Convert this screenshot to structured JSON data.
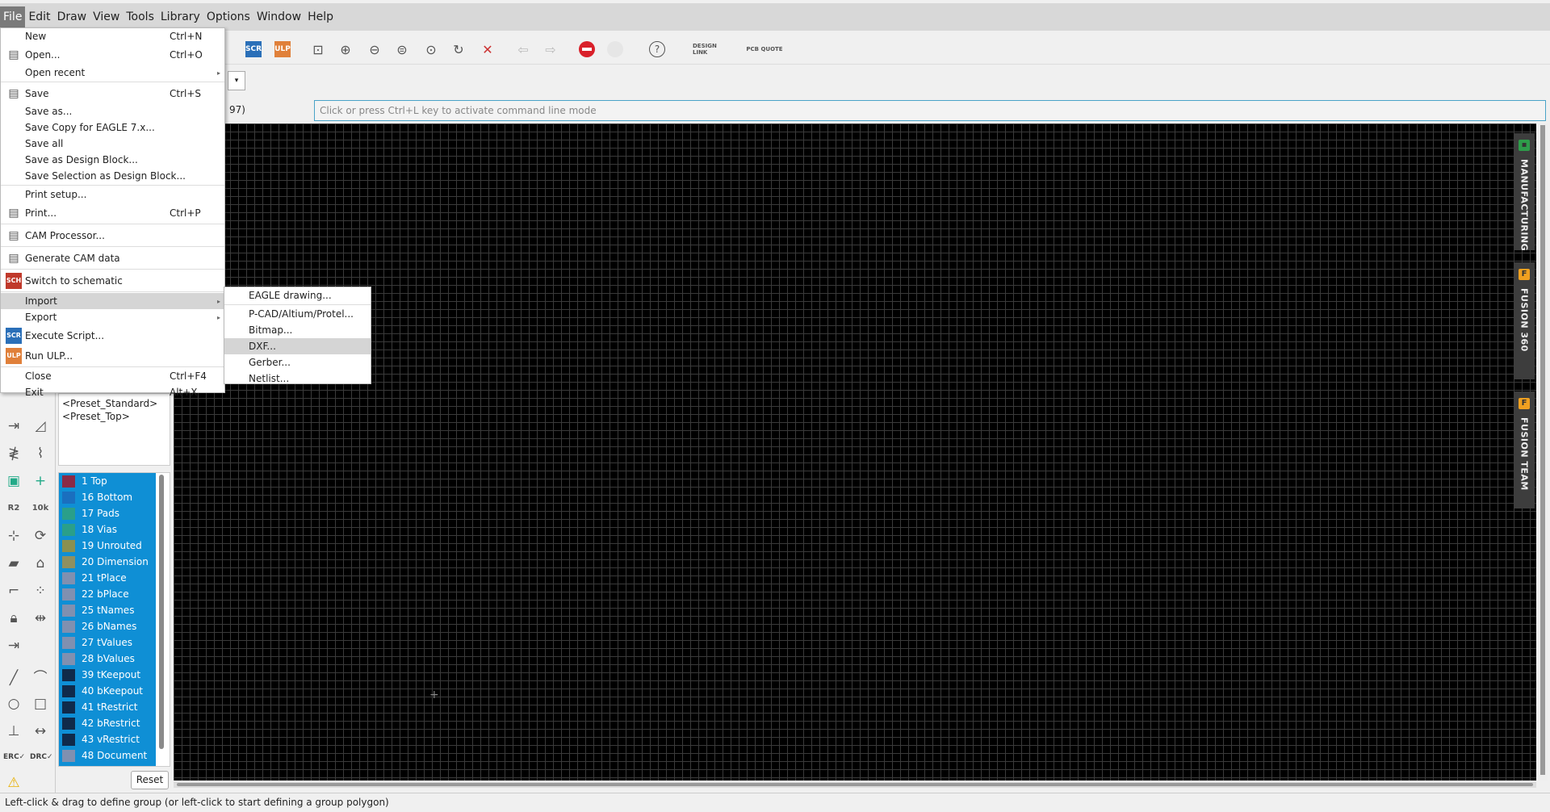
{
  "menubar": [
    "File",
    "Edit",
    "Draw",
    "View",
    "Tools",
    "Library",
    "Options",
    "Window",
    "Help"
  ],
  "toolbar": {
    "scr": "SCR",
    "ulp": "ULP",
    "design_link": "DESIGN LINK",
    "pcb_quote": "PCB QUOTE",
    "help": "?"
  },
  "coord_text": "97)",
  "command_placeholder": "Click or press Ctrl+L key to activate command line mode",
  "right_tabs": [
    {
      "label": "MANUFACTURING",
      "icon": "chip-icon",
      "color": "#2e9c4a"
    },
    {
      "label": "FUSION 360",
      "icon": "fusion-icon",
      "color": "#f0a020"
    },
    {
      "label": "FUSION TEAM",
      "icon": "fusion-icon",
      "color": "#f0a020"
    }
  ],
  "presets": [
    "<Preset_Standard>",
    "<Preset_Top>"
  ],
  "layers": [
    {
      "label": "1 Top",
      "color": "#8b2a45"
    },
    {
      "label": "16 Bottom",
      "color": "#1a6fbf"
    },
    {
      "label": "17 Pads",
      "color": "#2a9f8a"
    },
    {
      "label": "18 Vias",
      "color": "#2a9f8a"
    },
    {
      "label": "19 Unrouted",
      "color": "#8a9050"
    },
    {
      "label": "20 Dimension",
      "color": "#8f9060"
    },
    {
      "label": "21 tPlace",
      "color": "#8090b0"
    },
    {
      "label": "22 bPlace",
      "color": "#8090b0"
    },
    {
      "label": "25 tNames",
      "color": "#8090b0"
    },
    {
      "label": "26 bNames",
      "color": "#8090b0"
    },
    {
      "label": "27 tValues",
      "color": "#8090b0"
    },
    {
      "label": "28 bValues",
      "color": "#8090b0"
    },
    {
      "label": "39 tKeepout",
      "color": "#102a4a"
    },
    {
      "label": "40 bKeepout",
      "color": "#102a4a"
    },
    {
      "label": "41 tRestrict",
      "color": "#102a4a"
    },
    {
      "label": "42 bRestrict",
      "color": "#102a4a"
    },
    {
      "label": "43 vRestrict",
      "color": "#102a4a"
    },
    {
      "label": "48 Document",
      "color": "#8090b0"
    }
  ],
  "reset_label": "Reset",
  "status_text": "Left-click & drag to define group (or left-click to start defining a group polygon)",
  "file_menu": [
    [
      {
        "label": "New",
        "shortcut": "Ctrl+N"
      },
      {
        "label": "Open...",
        "shortcut": "Ctrl+O",
        "icon": "open-icon"
      },
      {
        "label": "Open recent",
        "submenu": true
      }
    ],
    [
      {
        "label": "Save",
        "shortcut": "Ctrl+S",
        "icon": "save-icon"
      },
      {
        "label": "Save as..."
      },
      {
        "label": "Save Copy for EAGLE 7.x..."
      },
      {
        "label": "Save all"
      },
      {
        "label": "Save as Design Block..."
      },
      {
        "label": "Save Selection as Design Block..."
      }
    ],
    [
      {
        "label": "Print setup..."
      },
      {
        "label": "Print...",
        "shortcut": "Ctrl+P",
        "icon": "printer-icon"
      }
    ],
    [
      {
        "label": "CAM Processor...",
        "icon": "cam-icon"
      }
    ],
    [
      {
        "label": "Generate CAM data",
        "icon": "generate-cam-icon"
      }
    ],
    [
      {
        "label": "Switch to schematic",
        "icon": "sch-brd-icon",
        "badge": "SCH"
      }
    ],
    [
      {
        "label": "Import",
        "submenu": true,
        "highlighted": true
      },
      {
        "label": "Export",
        "submenu": true
      },
      {
        "label": "Execute Script...",
        "icon": "scr-icon",
        "badge": "SCR"
      },
      {
        "label": "Run ULP...",
        "icon": "ulp-icon",
        "badge": "ULP"
      }
    ],
    [
      {
        "label": "Close",
        "shortcut": "Ctrl+F4"
      },
      {
        "label": "Exit",
        "shortcut": "Alt+X"
      }
    ]
  ],
  "import_submenu": [
    {
      "label": "EAGLE drawing..."
    },
    {
      "label": "P-CAD/Altium/Protel..."
    },
    {
      "label": "Bitmap..."
    },
    {
      "label": "DXF...",
      "highlighted": true
    },
    {
      "label": "Gerber..."
    },
    {
      "label": "Netlist..."
    }
  ]
}
